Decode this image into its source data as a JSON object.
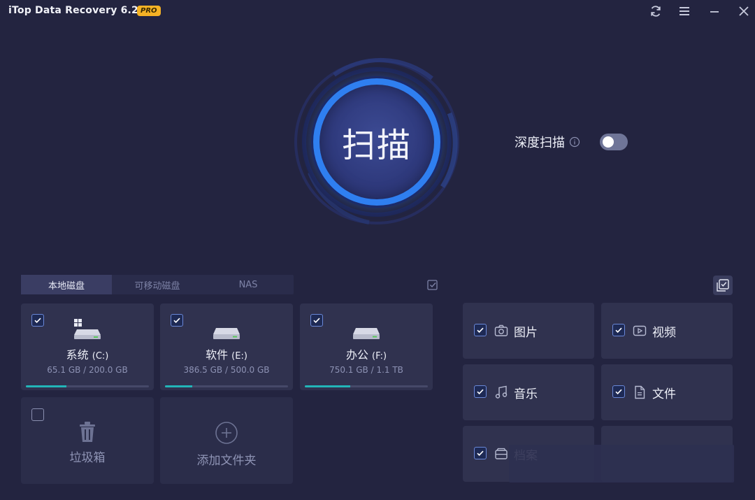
{
  "app": {
    "title": "iTop Data Recovery 6.2",
    "badge": "PRO",
    "window_controls": [
      "refresh-icon",
      "menu-icon",
      "minimize-icon",
      "close-icon"
    ]
  },
  "scan": {
    "button_label": "扫描",
    "deep_scan_label": "深度扫描",
    "deep_scan_enabled": false
  },
  "disk_tabs": [
    {
      "label": "本地磁盘",
      "active": true
    },
    {
      "label": "可移动磁盘",
      "active": false
    },
    {
      "label": "NAS",
      "active": false
    }
  ],
  "disks": [
    {
      "name": "系统",
      "letter": "(C:)",
      "size": "65.1 GB / 200.0 GB",
      "checked": true,
      "used_fraction": 0.33
    },
    {
      "name": "软件",
      "letter": "(E:)",
      "size": "386.5 GB / 500.0 GB",
      "checked": true,
      "used_fraction": 0.22
    },
    {
      "name": "办公",
      "letter": "(F:)",
      "size": "750.1 GB / 1.1 TB",
      "checked": true,
      "used_fraction": 0.37
    }
  ],
  "special": {
    "recycle_bin": "垃圾箱",
    "add_folder": "添加文件夹"
  },
  "file_types": [
    {
      "label": "图片",
      "icon": "camera-icon",
      "checked": true
    },
    {
      "label": "视频",
      "icon": "video-icon",
      "checked": true
    },
    {
      "label": "音乐",
      "icon": "music-icon",
      "checked": true
    },
    {
      "label": "文件",
      "icon": "document-icon",
      "checked": true
    },
    {
      "label": "档案",
      "icon": "archive-icon",
      "checked": true
    }
  ],
  "colors": {
    "background": "#232440",
    "accent": "#2f7ff0",
    "badge": "#f5b225",
    "progress": "#22b5b8"
  }
}
